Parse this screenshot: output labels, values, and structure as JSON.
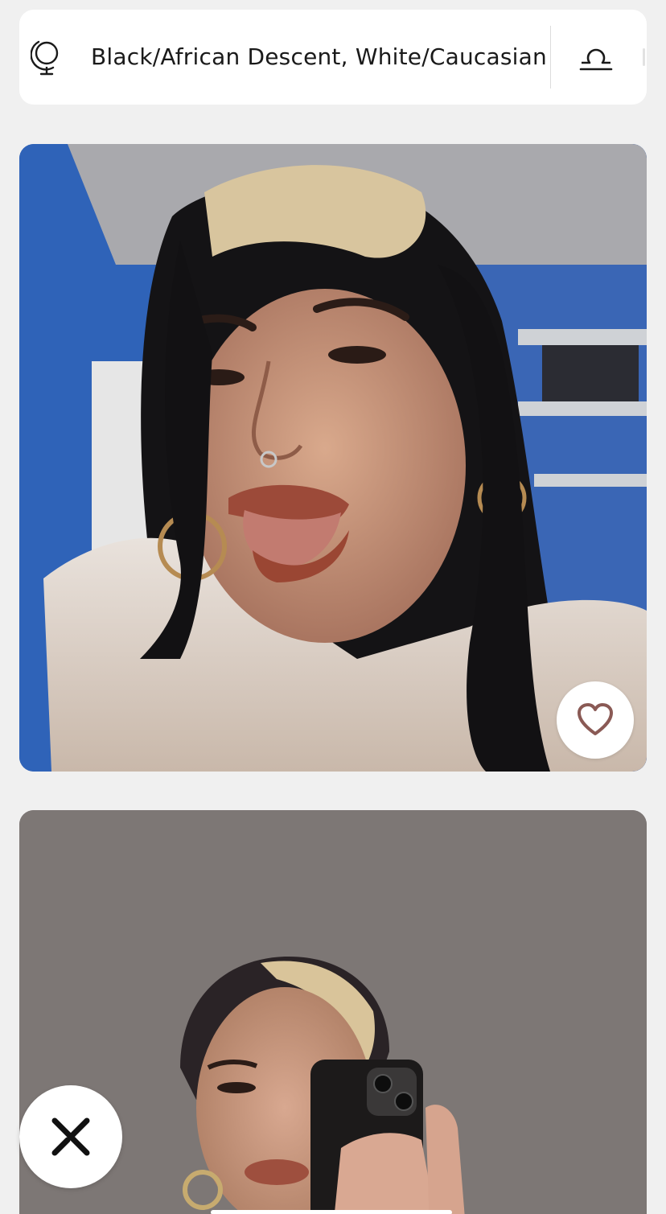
{
  "profile_info": {
    "ethnicity": "Black/African Descent, White/Caucasian",
    "ethnicity_icon": "globe-icon",
    "zodiac_icon": "libra-icon"
  },
  "photos": [
    {
      "name": "profile-photo-1",
      "description_icon": "photo"
    },
    {
      "name": "profile-photo-2",
      "description_icon": "photo"
    }
  ],
  "actions": {
    "like_icon": "heart-icon",
    "skip_icon": "x-icon"
  },
  "colors": {
    "background": "#f0f0f0",
    "card": "#ffffff",
    "text": "#1a1a1a",
    "icon": "#1a1a1a",
    "like_heart": "#8a5a55"
  }
}
